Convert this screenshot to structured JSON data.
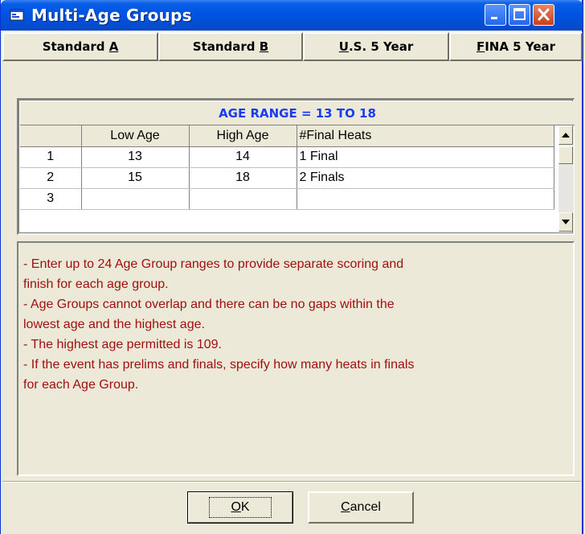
{
  "window": {
    "title": "Multi-Age Groups",
    "title_bar_color": "#0054e3",
    "controls": [
      "minimize-icon",
      "maximize-icon",
      "close-icon"
    ]
  },
  "toolbar": {
    "buttons": [
      {
        "label_prefix": "Standard ",
        "label_accel": "A",
        "label_suffix": ""
      },
      {
        "label_prefix": "Standard ",
        "label_accel": "B",
        "label_suffix": ""
      },
      {
        "label_prefix": "",
        "label_accel": "U",
        "label_suffix": ".S. 5 Year"
      },
      {
        "label_prefix": "",
        "label_accel": "F",
        "label_suffix": "INA 5 Year"
      }
    ]
  },
  "grid": {
    "age_range_title": "AGE RANGE = 13 TO 18",
    "age_range_color": "#1a3cf0",
    "columns": [
      "",
      "Low Age",
      "High Age",
      "#Final Heats"
    ],
    "rows": [
      {
        "num": "1",
        "low": "13",
        "high": "14",
        "final": "1 Final"
      },
      {
        "num": "2",
        "low": "15",
        "high": "18",
        "final": "2 Finals"
      },
      {
        "num": "3",
        "low": "",
        "high": "",
        "final": ""
      }
    ]
  },
  "info": {
    "text_color": "#a01010",
    "lines": [
      "- Enter up to 24 Age Group ranges to provide separate scoring and",
      "finish for each age group.",
      "- Age Groups cannot overlap and there can be no gaps within the",
      "lowest age and the highest age.",
      "- The highest age permitted is 109.",
      "- If the event has prelims and finals, specify how many heats in finals",
      "for each Age Group."
    ]
  },
  "buttons": {
    "ok_accel": "O",
    "ok_rest": "K",
    "cancel_accel": "C",
    "cancel_rest": "ancel"
  }
}
